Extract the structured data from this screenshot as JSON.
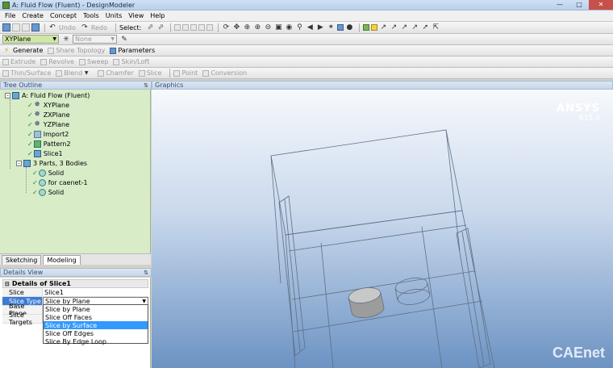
{
  "window": {
    "title": "A: Fluid Flow (Fluent) - DesignModeler"
  },
  "menu": [
    "File",
    "Create",
    "Concept",
    "Tools",
    "Units",
    "View",
    "Help"
  ],
  "toolbar1": {
    "undo": "Undo",
    "redo": "Redo",
    "select": "Select:"
  },
  "toolbar2": {
    "plane": "XYPlane",
    "sketch": "None"
  },
  "toolbar3": {
    "generate": "Generate",
    "share_topology": "Share Topology",
    "parameters": "Parameters"
  },
  "toolbar4": {
    "extrude": "Extrude",
    "revolve": "Revolve",
    "sweep": "Sweep",
    "skin_loft": "Skin/Loft"
  },
  "toolbar5": {
    "thin_surface": "Thin/Surface",
    "blend": "Blend",
    "chamfer": "Chamfer",
    "slice": "Slice",
    "point": "Point",
    "conversion": "Conversion"
  },
  "tree_outline": {
    "header": "Tree Outline",
    "items": [
      "A: Fluid Flow (Fluent)",
      "XYPlane",
      "ZXPlane",
      "YZPlane",
      "Import2",
      "Pattern2",
      "Slice1",
      "3 Parts, 3 Bodies",
      "Solid",
      "for caenet-1",
      "Solid"
    ]
  },
  "tabs": [
    "Sketching",
    "Modeling"
  ],
  "details": {
    "header": "Details View",
    "title": "Details of Slice1",
    "rows": [
      {
        "key": "Slice",
        "value": "Slice1"
      },
      {
        "key": "Slice Type",
        "value": "Slice by Plane"
      },
      {
        "key": "Base Plane",
        "value": ""
      },
      {
        "key": "Slice Targets",
        "value": ""
      }
    ],
    "options": [
      "Slice by Plane",
      "Slice Off Faces",
      "Slice by Surface",
      "Slice Off Edges",
      "Slice By Edge Loop"
    ],
    "selected_option": "Slice by Surface"
  },
  "graphics": {
    "header": "Graphics",
    "brand": "ANSYS",
    "version": "R15.0",
    "watermark": "CAEnet"
  },
  "colors": {
    "tree_bg": "#d8ecc8",
    "selection": "#3399ff",
    "graphics_top": "#f7f9fc",
    "graphics_bottom": "#6c93c3"
  }
}
